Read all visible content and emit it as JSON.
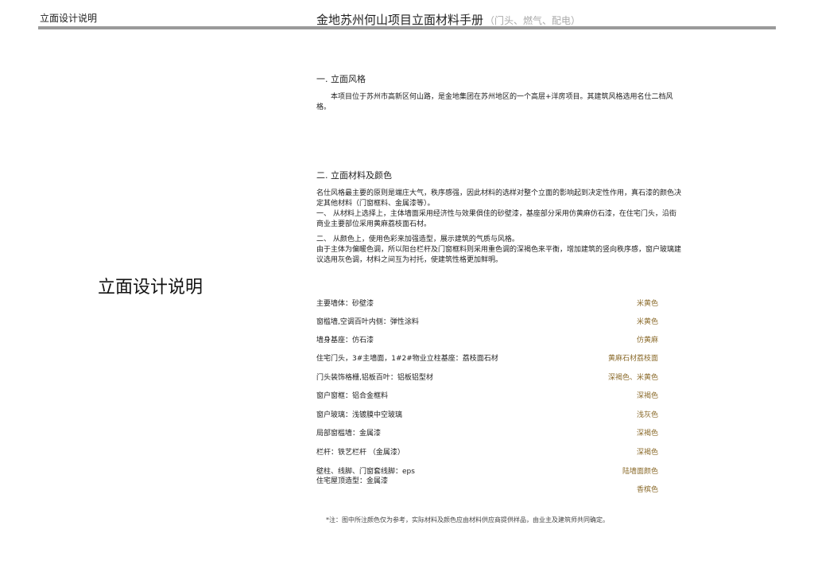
{
  "header": {
    "left_label": "立面设计说明",
    "title": "金地苏州何山项目立面材料手册",
    "subtitle": "（门头、燃气、配电）"
  },
  "side_title": "立面设计说明",
  "section1": {
    "title": "一. 立面风格",
    "body": "本项目位于苏州市高新区何山路，是金地集团在苏州地区的一个高层+洋房项目。其建筑风格选用名仕二档风格。"
  },
  "section2": {
    "title": "二. 立面材料及颜色",
    "p1": "名仕风格最主要的原则是端庄大气，秩序感强，因此材料的选样对整个立面的影响起到决定性作用，真石漆的颜色决定其他材料（门窗框料、金属漆等）。",
    "p2": "一、   从材料上选择上，主体墙面采用经济性与效果俱佳的砂壁漆，基座部分采用仿黄麻仿石漆，在住宅门头，沿街商业主要部位采用黄麻荔枝面石材。",
    "p3": "二、   从颜色上，使用色彩来加强造型，展示建筑的气质与风格。",
    "p4": "由于主体为偏暖色调，所以阳台栏杆及门窗框料则采用重色调的深褐色来平衡，增加建筑的竖向秩序感，窗户玻璃建议选用灰色调，材料之间互为衬托，使建筑性格更加鲜明。"
  },
  "materials": [
    {
      "label": "主要墙体：砂壁漆",
      "color": "米黄色"
    },
    {
      "label": "窗槛墙,空调百叶内侧：弹性涂料",
      "color": "米黄色"
    },
    {
      "label": "墙身基座：仿石漆",
      "color": "仿黄麻"
    },
    {
      "label": "住宅门头，3#主墙面，1#2#物业立柱基座：荔枝面石材",
      "color": "黄麻石材荔枝面"
    },
    {
      "label": "门头装饰格栅,铝板百叶：铝板铝型材",
      "color": "深褐色、米黄色"
    },
    {
      "label": "窗户窗框：铝合金框料",
      "color": "深褐色"
    },
    {
      "label": "窗户玻璃：浅镀膜中空玻璃",
      "color": "浅灰色"
    },
    {
      "label": "局部窗槛墙：金属漆",
      "color": "深褐色"
    },
    {
      "label": "栏杆：铁艺栏杆 （金属漆）",
      "color": "深褐色"
    },
    {
      "label": "壁柱、线脚、门窗套线脚：eps",
      "color": "陆墙面颜色"
    },
    {
      "label": "住宅屋顶造型：金属漆",
      "color": "香槟色"
    }
  ],
  "note": "*注：图中所注颜色仅为参考，实际材料及颜色应由材料供应商提供样品，由业主及建筑师共同确定。"
}
